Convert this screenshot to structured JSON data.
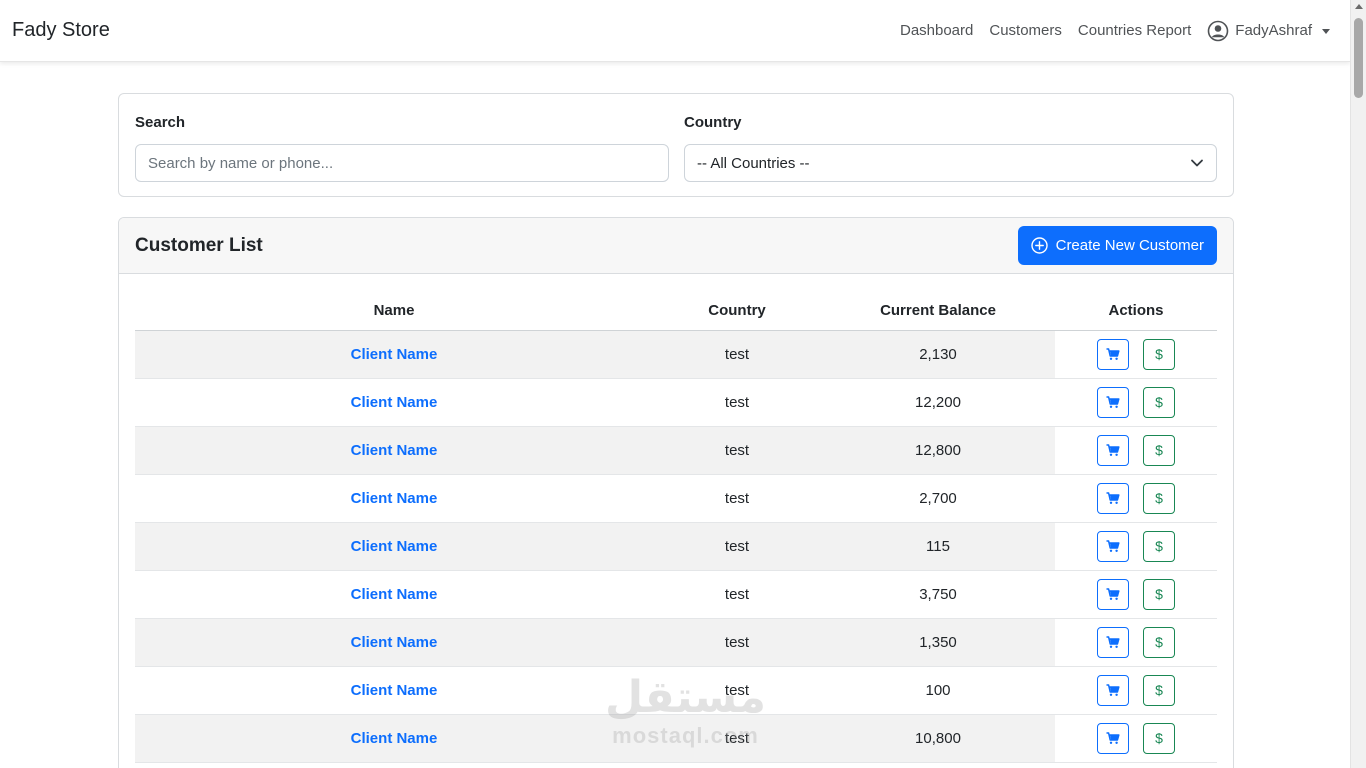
{
  "navbar": {
    "brand": "Fady Store",
    "links": [
      {
        "label": "Dashboard"
      },
      {
        "label": "Customers"
      },
      {
        "label": "Countries Report"
      }
    ],
    "user": {
      "name": "FadyAshraf",
      "icon": "user-circle-icon"
    }
  },
  "filters": {
    "search": {
      "label": "Search",
      "placeholder": "Search by name or phone..."
    },
    "country": {
      "label": "Country",
      "selected": "-- All Countries --"
    }
  },
  "customer_list": {
    "title": "Customer List",
    "create_button": "Create New Customer",
    "columns": [
      "Name",
      "Country",
      "Current Balance",
      "Actions"
    ],
    "rows": [
      {
        "name": "Client Name",
        "country": "test",
        "balance": "2,130"
      },
      {
        "name": "Client Name",
        "country": "test",
        "balance": "12,200"
      },
      {
        "name": "Client Name",
        "country": "test",
        "balance": "12,800"
      },
      {
        "name": "Client Name",
        "country": "test",
        "balance": "2,700"
      },
      {
        "name": "Client Name",
        "country": "test",
        "balance": "115"
      },
      {
        "name": "Client Name",
        "country": "test",
        "balance": "3,750"
      },
      {
        "name": "Client Name",
        "country": "test",
        "balance": "1,350"
      },
      {
        "name": "Client Name",
        "country": "test",
        "balance": "100"
      },
      {
        "name": "Client Name",
        "country": "test",
        "balance": "10,800"
      }
    ],
    "action_pay_label": "$"
  },
  "watermark": {
    "arabic": "مستقل",
    "latin": "mostaql.com"
  },
  "colors": {
    "primary": "#0d6efd",
    "success": "#198754",
    "stripe": "#f2f2f2"
  }
}
